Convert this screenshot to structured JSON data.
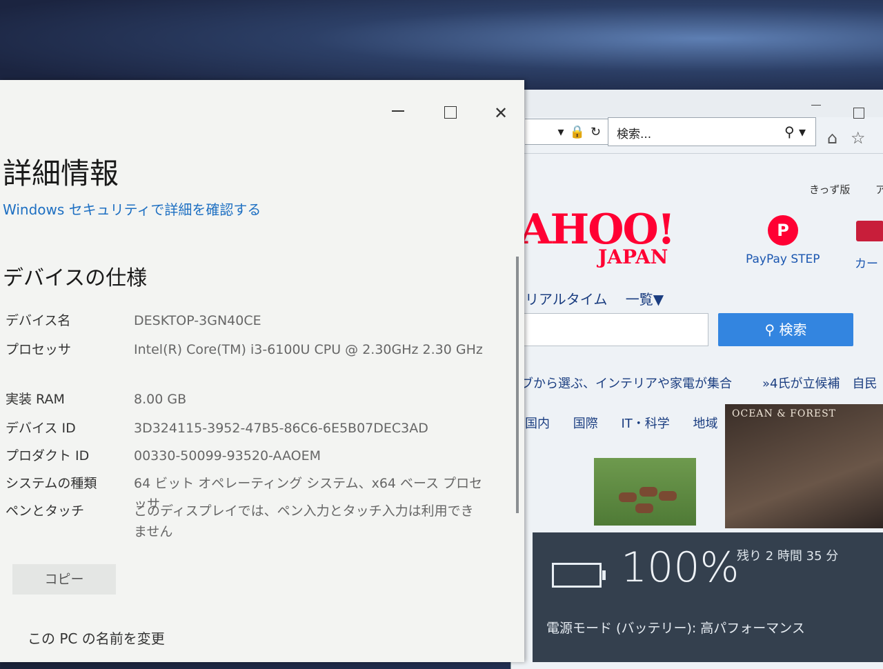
{
  "browser": {
    "search_placeholder": "検索...",
    "kids_label": "きっず版",
    "kids_label_cut": "アプ",
    "yahoo_logo": "AHOO!",
    "yahoo_sub": "JAPAN",
    "paypay_icon_letter": "P",
    "paypay_label": "PayPay STEP",
    "card_label": "カー",
    "tabs": [
      "リアルタイム",
      "一覧▼"
    ],
    "search_button": "検索",
    "promo_text": "ブから選ぶ、インテリアや家電が集合",
    "promo_text2": "»4氏が立候補　自民",
    "news_tabs": [
      "国内",
      "国際",
      "IT・科学",
      "地域"
    ],
    "ad_text": "OCEAN & FOREST"
  },
  "battery": {
    "percent": "100%",
    "remaining": "残り 2 時間 35 分",
    "power_mode": "電源モード (バッテリー): 高パフォーマンス"
  },
  "about": {
    "title": "詳細情報",
    "security_link": "Windows セキュリティで詳細を確認する",
    "specs_heading": "デバイスの仕様",
    "specs": [
      {
        "key": "デバイス名",
        "value": "DESKTOP-3GN40CE"
      },
      {
        "key": "プロセッサ",
        "value": "Intel(R) Core(TM) i3-6100U CPU @ 2.30GHz   2.30 GHz"
      },
      {
        "key": "実装 RAM",
        "value": "8.00 GB"
      },
      {
        "key": "デバイス ID",
        "value": "3D324115-3952-47B5-86C6-6E5B07DEC3AD"
      },
      {
        "key": "プロダクト ID",
        "value": "00330-50099-93520-AAOEM"
      },
      {
        "key": "システムの種類",
        "value": "64 ビット オペレーティング システム、x64 ベース プロセッサ"
      },
      {
        "key": "ペンとタッチ",
        "value": "このディスプレイでは、ペン入力とタッチ入力は利用できません"
      }
    ],
    "copy_button": "コピー",
    "rename_link": "この PC の名前を変更"
  }
}
